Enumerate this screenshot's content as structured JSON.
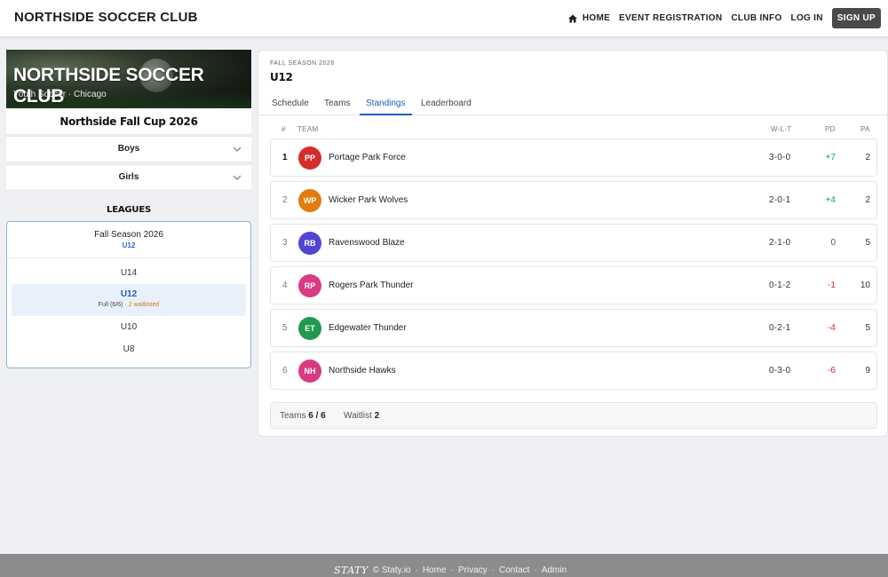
{
  "header": {
    "brand": "NORTHSIDE SOCCER CLUB",
    "nav": {
      "home": "HOME",
      "event_registration": "EVENT REGISTRATION",
      "club_info": "CLUB INFO",
      "log_in": "LOG IN",
      "sign_up": "SIGN UP"
    }
  },
  "sidebar": {
    "banner_title": "NORTHSIDE SOCCER CLUB",
    "banner_subtitle": "Youth Soccer · Chicago",
    "cup_title": "Northside Fall Cup 2026",
    "accordions": [
      "Boys",
      "Girls"
    ],
    "leagues_heading": "LEAGUES",
    "season": {
      "name": "Fall Season 2026",
      "division": "U12"
    },
    "divisions": {
      "u14": "U14",
      "u12": {
        "label": "U12",
        "status": "Full (6/6)",
        "sep": " · ",
        "waitlist": "2 waitlisted"
      },
      "u10": "U10",
      "u8": "U8"
    }
  },
  "main": {
    "season_label": "FALL SEASON 2026",
    "division_title": "U12",
    "tabs": [
      "Schedule",
      "Teams",
      "Standings",
      "Leaderboard"
    ],
    "active_tab": "Standings",
    "columns": {
      "rank": "#",
      "team": "TEAM",
      "wlt": "W-L-T",
      "pd": "PD",
      "pa": "PA"
    },
    "standings": [
      {
        "rank": "1",
        "initials": "PP",
        "team": "Portage Park Force",
        "wlt": "3-0-0",
        "pd": "+7",
        "pa": "2",
        "color": "#d62c2c"
      },
      {
        "rank": "2",
        "initials": "WP",
        "team": "Wicker Park Wolves",
        "wlt": "2-0-1",
        "pd": "+4",
        "pa": "2",
        "color": "#e07b0c"
      },
      {
        "rank": "3",
        "initials": "RB",
        "team": "Ravenswood Blaze",
        "wlt": "2-1-0",
        "pd": "0",
        "pa": "5",
        "color": "#4f46d6"
      },
      {
        "rank": "4",
        "initials": "RP",
        "team": "Rogers Park Thunder",
        "wlt": "0-1-2",
        "pd": "-1",
        "pa": "10",
        "color": "#d93a82"
      },
      {
        "rank": "5",
        "initials": "ET",
        "team": "Edgewater Thunder",
        "wlt": "0-2-1",
        "pd": "-4",
        "pa": "5",
        "color": "#1f9a4e"
      },
      {
        "rank": "6",
        "initials": "NH",
        "team": "Northside Hawks",
        "wlt": "0-3-0",
        "pd": "-6",
        "pa": "9",
        "color": "#d93a82"
      }
    ],
    "summary": {
      "teams_label": "Teams",
      "teams_value": "6 / 6",
      "waitlist_label": "Waitlist",
      "waitlist_value": "2"
    }
  },
  "footer": {
    "logo": "STATY",
    "copyright": "© Staty.io",
    "sep": "·",
    "links": [
      "Home",
      "Privacy",
      "Contact",
      "Admin"
    ]
  }
}
